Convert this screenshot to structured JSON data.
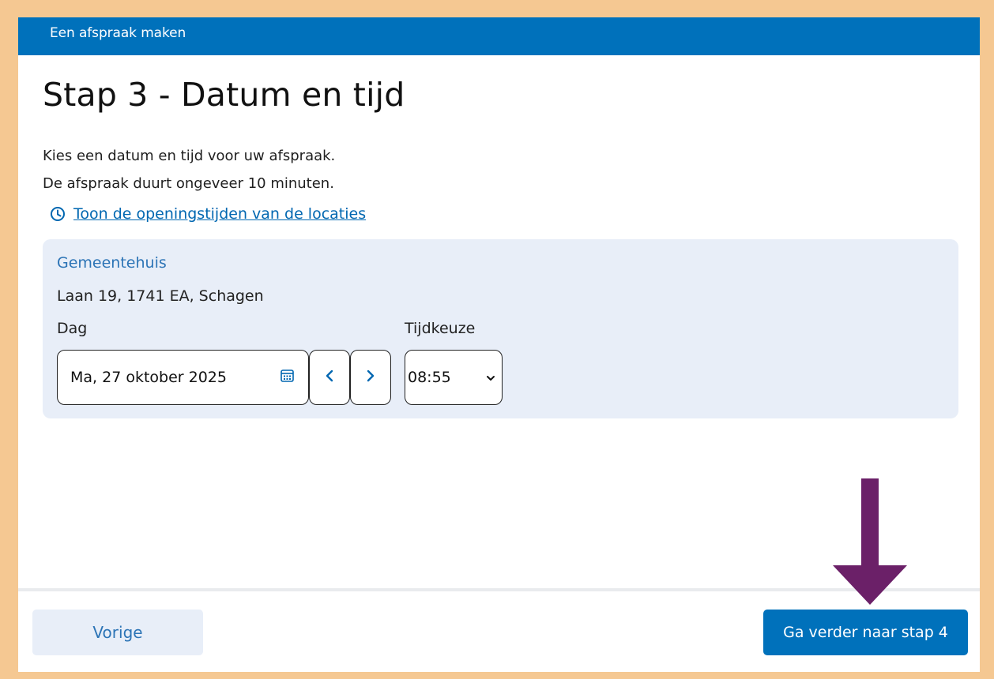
{
  "header": {
    "title": "Een afspraak maken"
  },
  "page": {
    "title": "Stap 3 - Datum en tijd",
    "intro_line1": "Kies een datum en tijd voor uw afspraak.",
    "intro_line2": "De afspraak duurt ongeveer 10 minuten.",
    "hours_link": "Toon de openingstijden van de locaties"
  },
  "location": {
    "name": "Gemeentehuis",
    "address": "Laan 19, 1741 EA, Schagen",
    "day_label": "Dag",
    "time_label": "Tijdkeuze",
    "date_value": "Ma, 27 oktober 2025",
    "time_value": "08:55"
  },
  "footer": {
    "prev_label": "Vorige",
    "next_label": "Ga verder naar stap 4"
  },
  "colors": {
    "outer_border": "#f5c892",
    "primary": "#0071bb",
    "panel_bg": "#e8eef8",
    "link": "#0067b1",
    "arrow": "#6b2068"
  },
  "icons": {
    "clock": "clock-icon",
    "calendar": "calendar-icon",
    "prev": "chevron-left-icon",
    "next": "chevron-right-icon",
    "dropdown": "chevron-down-icon",
    "annotation": "arrow-down-icon"
  }
}
